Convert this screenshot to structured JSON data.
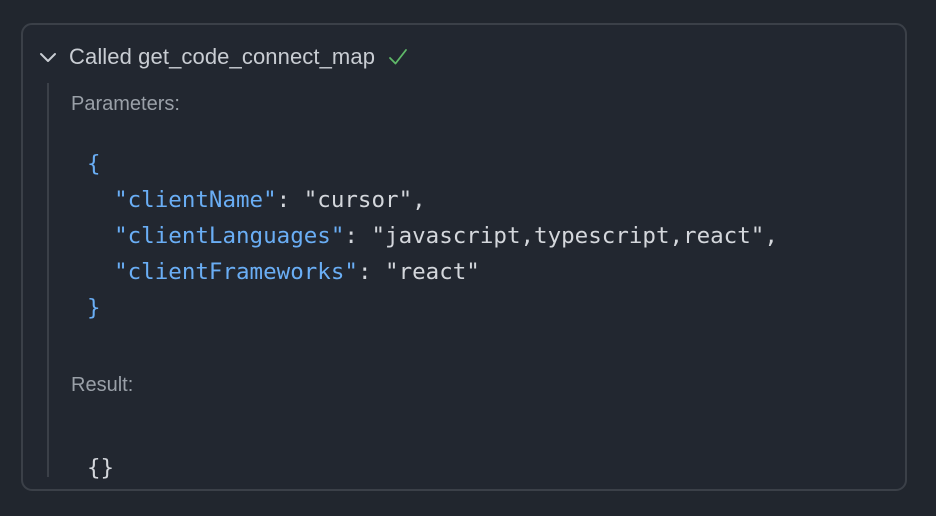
{
  "tool_call": {
    "title": "Called get_code_connect_map",
    "status_icon": "check-icon",
    "expanded": true,
    "colors": {
      "background": "#21262e",
      "border": "#3b4048",
      "key": "#6aaef5",
      "check": "#5fb868",
      "text": "#c9cdd3"
    }
  },
  "parameters": {
    "label": "Parameters:",
    "open_brace": "{",
    "close_brace": "}",
    "entries": [
      {
        "key": "\"clientName\"",
        "sep": ": ",
        "value": "\"cursor\"",
        "trail": ","
      },
      {
        "key": "\"clientLanguages\"",
        "sep": ": ",
        "value": "\"javascript,typescript,react\"",
        "trail": ","
      },
      {
        "key": "\"clientFrameworks\"",
        "sep": ": ",
        "value": "\"react\"",
        "trail": ""
      }
    ]
  },
  "result": {
    "label": "Result:",
    "value": "{}"
  }
}
